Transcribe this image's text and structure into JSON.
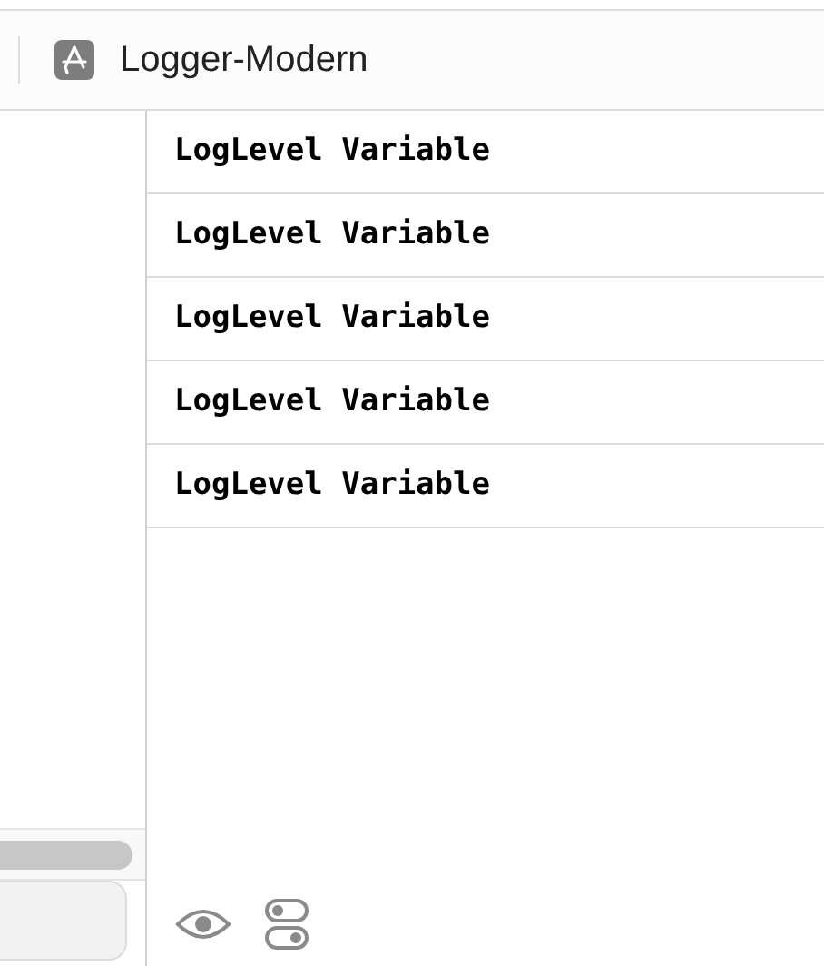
{
  "tab": {
    "title": "Logger-Modern"
  },
  "rows": [
    {
      "label": "LogLevel Variable"
    },
    {
      "label": "LogLevel Variable"
    },
    {
      "label": "LogLevel Variable"
    },
    {
      "label": "LogLevel Variable"
    },
    {
      "label": "LogLevel Variable"
    }
  ]
}
